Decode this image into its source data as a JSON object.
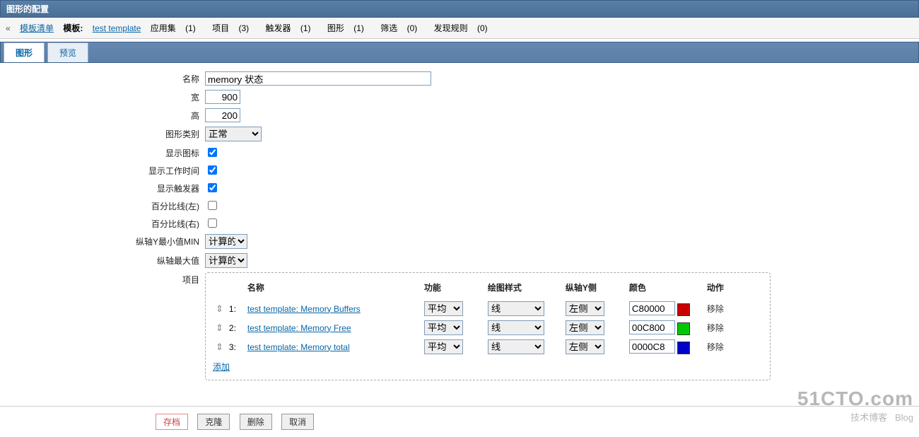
{
  "header": {
    "title": "图形的配置"
  },
  "breadcrumb": {
    "back_link": "模板清单",
    "template_label": "模板:",
    "template_name": "test template",
    "nav": [
      {
        "label": "应用集",
        "count": "(1)"
      },
      {
        "label": "项目",
        "count": "(3)"
      },
      {
        "label": "触发器",
        "count": "(1)"
      },
      {
        "label": "图形",
        "count": "(1)"
      },
      {
        "label": "筛选",
        "count": "(0)"
      },
      {
        "label": "发现规则",
        "count": "(0)"
      }
    ]
  },
  "tabs": {
    "graph": "图形",
    "preview": "预览"
  },
  "form": {
    "name_label": "名称",
    "name_value": "memory 状态",
    "width_label": "宽",
    "width_value": "900",
    "height_label": "高",
    "height_value": "200",
    "type_label": "图形类别",
    "type_value": "正常",
    "show_legend_label": "显示图标",
    "show_legend": true,
    "show_work_label": "显示工作时间",
    "show_work": true,
    "show_trig_label": "显示触发器",
    "show_trig": true,
    "percent_left_label": "百分比线(左)",
    "percent_left": false,
    "percent_right_label": "百分比线(右)",
    "percent_right": false,
    "yaxis_min_label": "纵轴Y最小值MIN",
    "yaxis_min_value": "计算的",
    "yaxis_max_label": "纵轴最大值",
    "yaxis_max_value": "计算的",
    "items_label": "项目"
  },
  "items": {
    "columns": {
      "name": "名称",
      "func": "功能",
      "draw": "绘图样式",
      "side": "纵轴Y侧",
      "color": "颜色",
      "action": "动作"
    },
    "add_label": "添加",
    "remove_label": "移除",
    "func_option": "平均",
    "draw_option": "线",
    "side_option": "左侧",
    "rows": [
      {
        "idx": "1:",
        "name": "test template: Memory Buffers",
        "color": "C80000",
        "swatch": "#C80000"
      },
      {
        "idx": "2:",
        "name": "test template: Memory Free",
        "color": "00C800",
        "swatch": "#00C800"
      },
      {
        "idx": "3:",
        "name": "test template: Memory total",
        "color": "0000C8",
        "swatch": "#0000C8"
      }
    ]
  },
  "buttons": {
    "save": "存档",
    "clone": "克隆",
    "delete": "删除",
    "cancel": "取消"
  },
  "watermark": {
    "domain": "51CTO.com",
    "sub": "技术博客",
    "tag": "Blog"
  }
}
